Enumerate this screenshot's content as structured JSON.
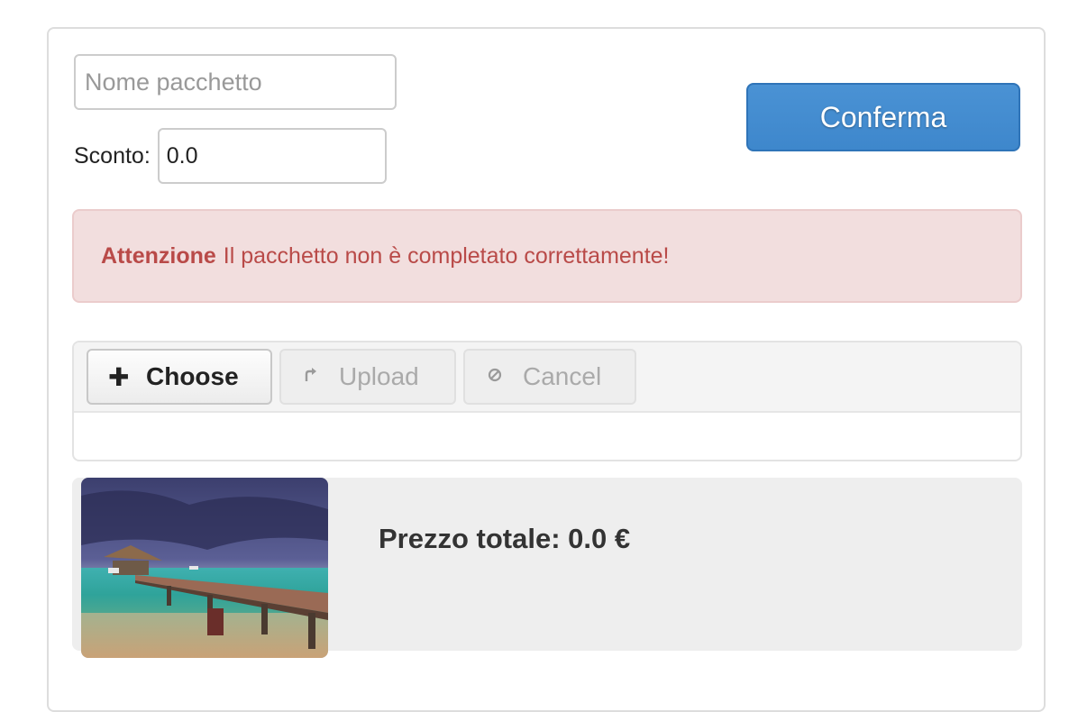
{
  "package_form": {
    "name_placeholder": "Nome pacchetto",
    "name_value": "",
    "discount_label": "Sconto:",
    "discount_value": "0.0",
    "confirm_label": "Conferma"
  },
  "alert": {
    "strong": "Attenzione",
    "message": "Il pacchetto non è completato correttamente!"
  },
  "uploader": {
    "choose_label": "Choose",
    "upload_label": "Upload",
    "cancel_label": "Cancel",
    "icons": {
      "choose": "plus-icon",
      "upload": "upload-arrow-icon",
      "cancel": "cancel-icon"
    }
  },
  "summary": {
    "total_text": "Prezzo totale: 0.0 €"
  },
  "colors": {
    "primary": "#428bca",
    "danger_bg": "#f2dede",
    "danger_text": "#b94a48"
  }
}
